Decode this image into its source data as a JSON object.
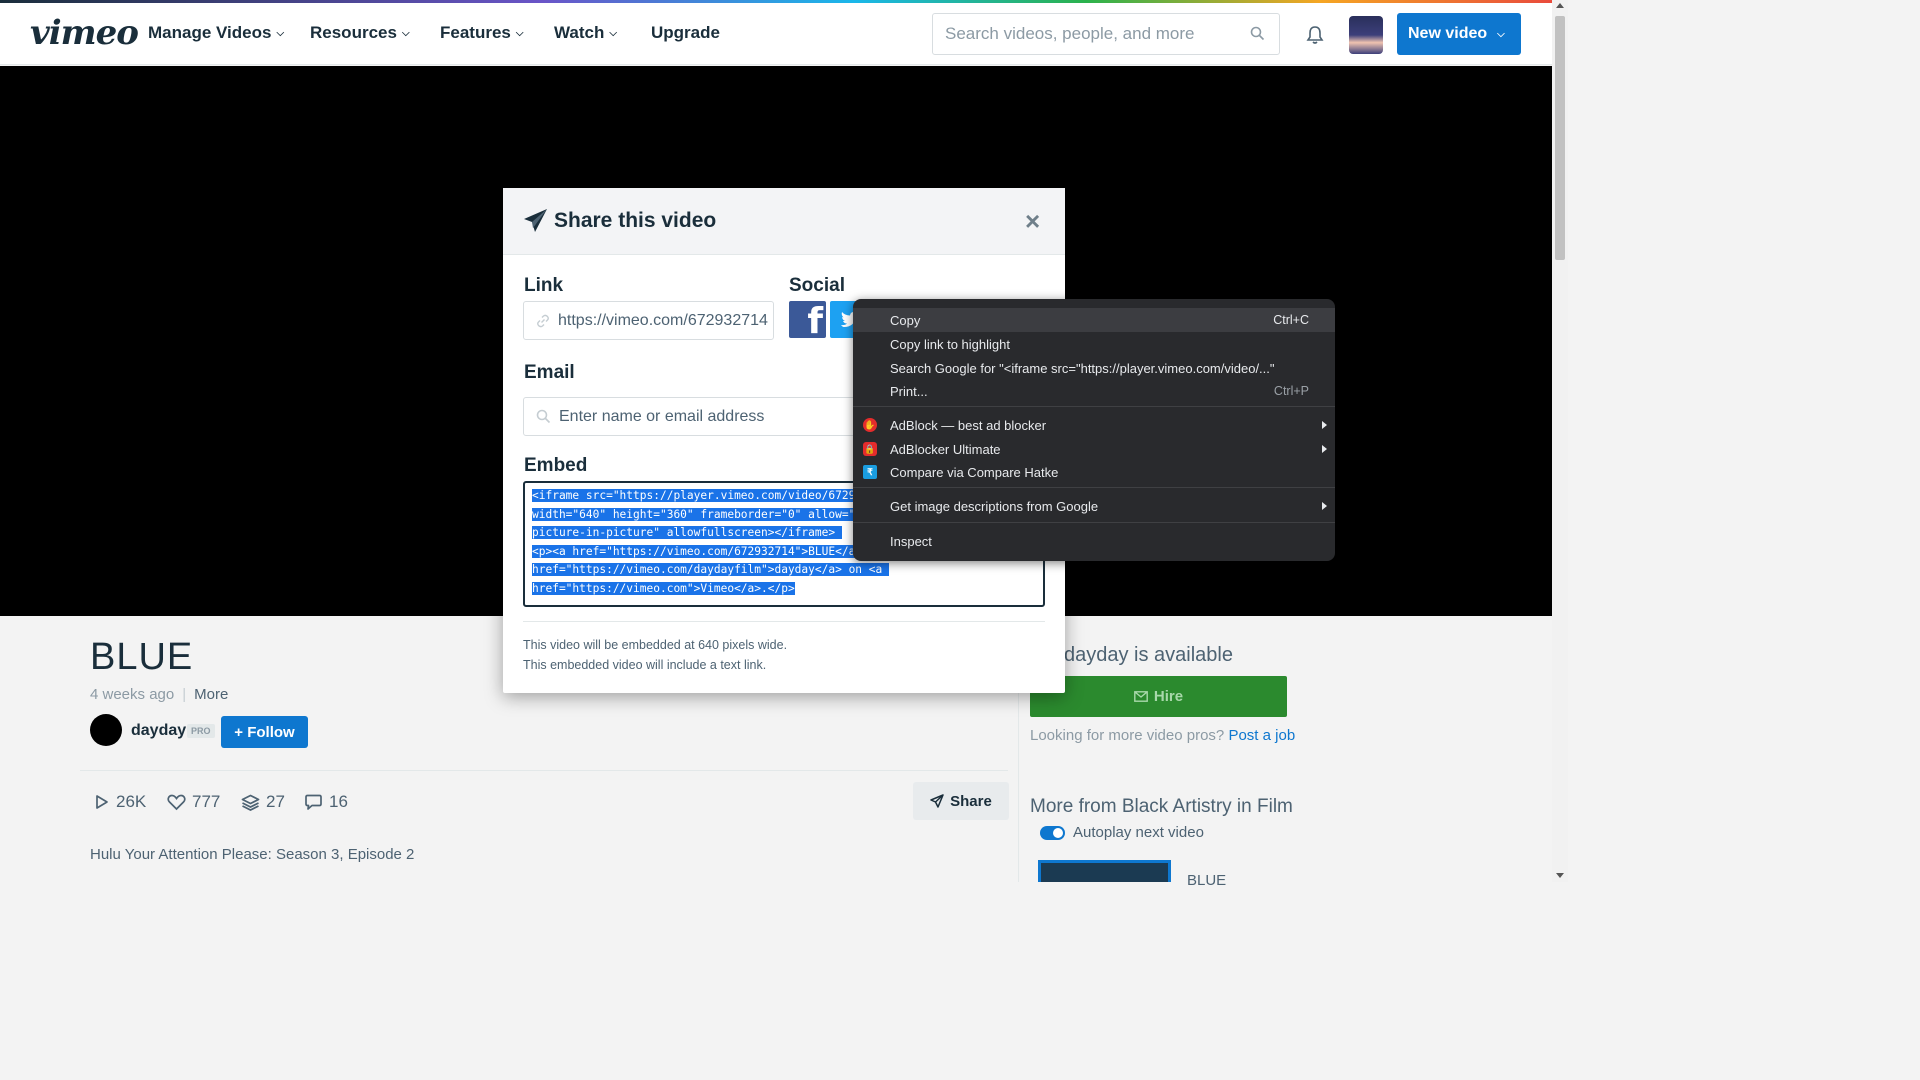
{
  "header": {
    "logo": "vimeo",
    "nav": [
      {
        "label": "Manage Videos",
        "has_dropdown": true
      },
      {
        "label": "Resources",
        "has_dropdown": true
      },
      {
        "label": "Features",
        "has_dropdown": true
      },
      {
        "label": "Watch",
        "has_dropdown": true
      },
      {
        "label": "Upgrade",
        "has_dropdown": false
      }
    ],
    "search_placeholder": "Search videos, people, and more",
    "new_video_label": "New video"
  },
  "video": {
    "title": "BLUE",
    "posted": "4 weeks ago",
    "more_label": "More",
    "author": "dayday",
    "pro_badge": "PRO",
    "follow_label": "+ Follow",
    "stats": {
      "plays": "26K",
      "likes": "777",
      "collections": "27",
      "comments": "16"
    },
    "share_label": "Share",
    "description": "Hulu Your Attention Please: Season 3, Episode 2"
  },
  "sidebar": {
    "available": "dayday is available",
    "hire_label": "Hire",
    "pros_text": "Looking for more video pros?",
    "post_job_link": "Post a job",
    "more_from": "More from Black Artistry in Film",
    "autoplay_label": "Autoplay next video",
    "next_video_title": "BLUE"
  },
  "modal": {
    "title": "Share this video",
    "close_label": "×",
    "link_label": "Link",
    "link_value": "https://vimeo.com/672932714",
    "social_label": "Social",
    "email_label": "Email",
    "email_placeholder": "Enter name or email address",
    "embed_label": "Embed",
    "embed_lines": [
      "<iframe src=\"https://player.vimeo.com/video/6729",
      "width=\"640\" height=\"360\" frameborder=\"0\" allow=\"",
      "picture-in-picture\" allowfullscreen></iframe> ",
      "<p><a href=\"https://vimeo.com/672932714\">BLUE</a",
      "href=\"https://vimeo.com/daydayfilm\">dayday</a> on <a ",
      "href=\"https://vimeo.com\">Vimeo</a>.</p>"
    ],
    "note_width": "This video will be embedded at 640 pixels wide.",
    "note_link": "This embedded video will include a text link."
  },
  "context_menu": {
    "items": [
      {
        "label": "Copy",
        "shortcut": "Ctrl+C",
        "highlighted": true
      },
      {
        "label": "Copy link to highlight"
      },
      {
        "label": "Search Google for \"<iframe src=\"https://player.vimeo.com/video/...\""
      },
      {
        "label": "Print...",
        "shortcut": "Ctrl+P"
      },
      {
        "label": "AdBlock — best ad blocker",
        "icon": "adblock-hand-icon",
        "submenu": true
      },
      {
        "label": "AdBlocker Ultimate",
        "icon": "lock-icon",
        "submenu": true
      },
      {
        "label": "Compare via Compare Hatke",
        "icon": "compare-hatke-icon"
      },
      {
        "label": "Get image descriptions from Google",
        "submenu": true
      },
      {
        "label": "Inspect"
      }
    ]
  },
  "colors": {
    "brand_blue": "#0e77cf",
    "hire_green": "#2b8a2e",
    "menu_bg": "#292a2d",
    "selection": "#1a73e8"
  }
}
